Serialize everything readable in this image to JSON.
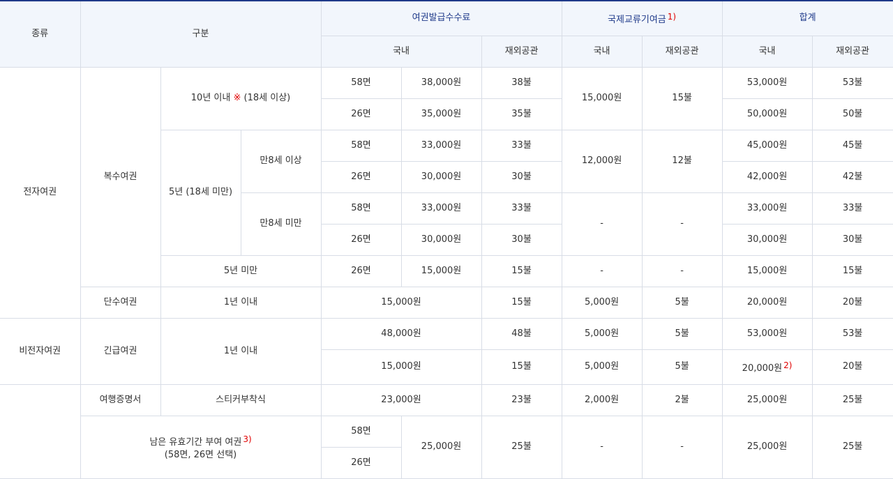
{
  "header": {
    "kind": "종류",
    "category": "구분",
    "issue_fee": "여권발급수수료",
    "intl_fee": "국제교류기여금",
    "intl_note": "1)",
    "total": "합계",
    "domestic": "국내",
    "overseas": "재외공관"
  },
  "labels": {
    "epassport": "전자여권",
    "multiple": "복수여권",
    "ten_years": "10년 이내",
    "ten_mark": "※",
    "ten_age": "(18세 이상)",
    "five_years": "5년 (18세 미만)",
    "age8_over": "만8세 이상",
    "age8_under": "만8세 미만",
    "under5": "5년 미만",
    "single": "단수여권",
    "within1": "1년 이내",
    "non_epassport": "비전자여권",
    "emergency": "긴급여권",
    "within1_b": "1년 이내",
    "travel_cert": "여행증명서",
    "sticker": "스티커부착식",
    "remaining_line1": "남은 유효기간 부여 여권",
    "remaining_note": "3)",
    "remaining_line2": "(58면, 26면 선택)",
    "p58": "58면",
    "p26": "26면",
    "dash": "-",
    "total_note": "2)"
  },
  "rows": {
    "r1": {
      "pages": "58면",
      "fee": "38,000원",
      "fee_o": "38불",
      "intl": "15,000원",
      "intl_o": "15불",
      "tot": "53,000원",
      "tot_o": "53불"
    },
    "r2": {
      "pages": "26면",
      "fee": "35,000원",
      "fee_o": "35불",
      "tot": "50,000원",
      "tot_o": "50불"
    },
    "r3": {
      "pages": "58면",
      "fee": "33,000원",
      "fee_o": "33불",
      "intl": "12,000원",
      "intl_o": "12불",
      "tot": "45,000원",
      "tot_o": "45불"
    },
    "r4": {
      "pages": "26면",
      "fee": "30,000원",
      "fee_o": "30불",
      "tot": "42,000원",
      "tot_o": "42불"
    },
    "r5": {
      "pages": "58면",
      "fee": "33,000원",
      "fee_o": "33불",
      "intl": "-",
      "intl_o": "-",
      "tot": "33,000원",
      "tot_o": "33불"
    },
    "r6": {
      "pages": "26면",
      "fee": "30,000원",
      "fee_o": "30불",
      "tot": "30,000원",
      "tot_o": "30불"
    },
    "r7": {
      "pages": "26면",
      "fee": "15,000원",
      "fee_o": "15불",
      "intl": "-",
      "intl_o": "-",
      "tot": "15,000원",
      "tot_o": "15불"
    },
    "r8": {
      "fee": "15,000원",
      "fee_o": "15불",
      "intl": "5,000원",
      "intl_o": "5불",
      "tot": "20,000원",
      "tot_o": "20불"
    },
    "r9": {
      "fee": "48,000원",
      "fee_o": "48불",
      "intl": "5,000원",
      "intl_o": "5불",
      "tot": "53,000원",
      "tot_o": "53불"
    },
    "r10": {
      "fee": "15,000원",
      "fee_o": "15불",
      "intl": "5,000원",
      "intl_o": "5불",
      "tot": "20,000원",
      "tot_o": "20불"
    },
    "r11": {
      "fee": "23,000원",
      "fee_o": "23불",
      "intl": "2,000원",
      "intl_o": "2불",
      "tot": "25,000원",
      "tot_o": "25불"
    },
    "r12": {
      "pages1": "58면",
      "pages2": "26면",
      "fee": "25,000원",
      "fee_o": "25불",
      "intl": "-",
      "intl_o": "-",
      "tot": "25,000원",
      "tot_o": "25불"
    }
  }
}
